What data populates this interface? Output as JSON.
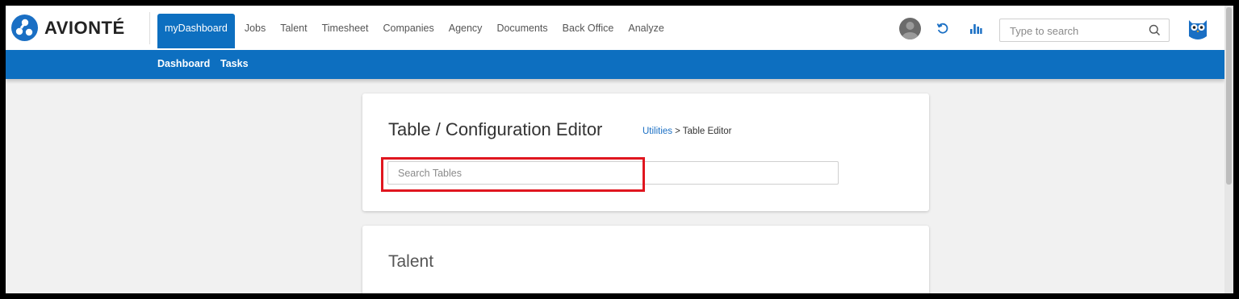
{
  "brand": {
    "name": "AVIONTÉ"
  },
  "nav": {
    "items": [
      {
        "label": "myDashboard",
        "active": true
      },
      {
        "label": "Jobs"
      },
      {
        "label": "Talent"
      },
      {
        "label": "Timesheet"
      },
      {
        "label": "Companies"
      },
      {
        "label": "Agency"
      },
      {
        "label": "Documents"
      },
      {
        "label": "Back Office"
      },
      {
        "label": "Analyze"
      }
    ]
  },
  "subnav": {
    "items": [
      {
        "label": "Dashboard"
      },
      {
        "label": "Tasks"
      }
    ]
  },
  "topsearch": {
    "placeholder": "Type to search"
  },
  "page": {
    "title": "Table / Configuration Editor",
    "breadcrumb": {
      "link": "Utilities",
      "separator": ">",
      "current": "Table Editor"
    },
    "search": {
      "placeholder": "Search Tables",
      "value": ""
    },
    "section_title": "Talent"
  },
  "colors": {
    "brand_blue": "#0d6fc0",
    "highlight_red": "#e0161f",
    "link_blue": "#1a6fc4"
  },
  "icons": [
    "avionte-logo-icon",
    "user-avatar-icon",
    "refresh-icon",
    "bar-chart-icon",
    "search-icon",
    "owl-mascot-icon"
  ]
}
